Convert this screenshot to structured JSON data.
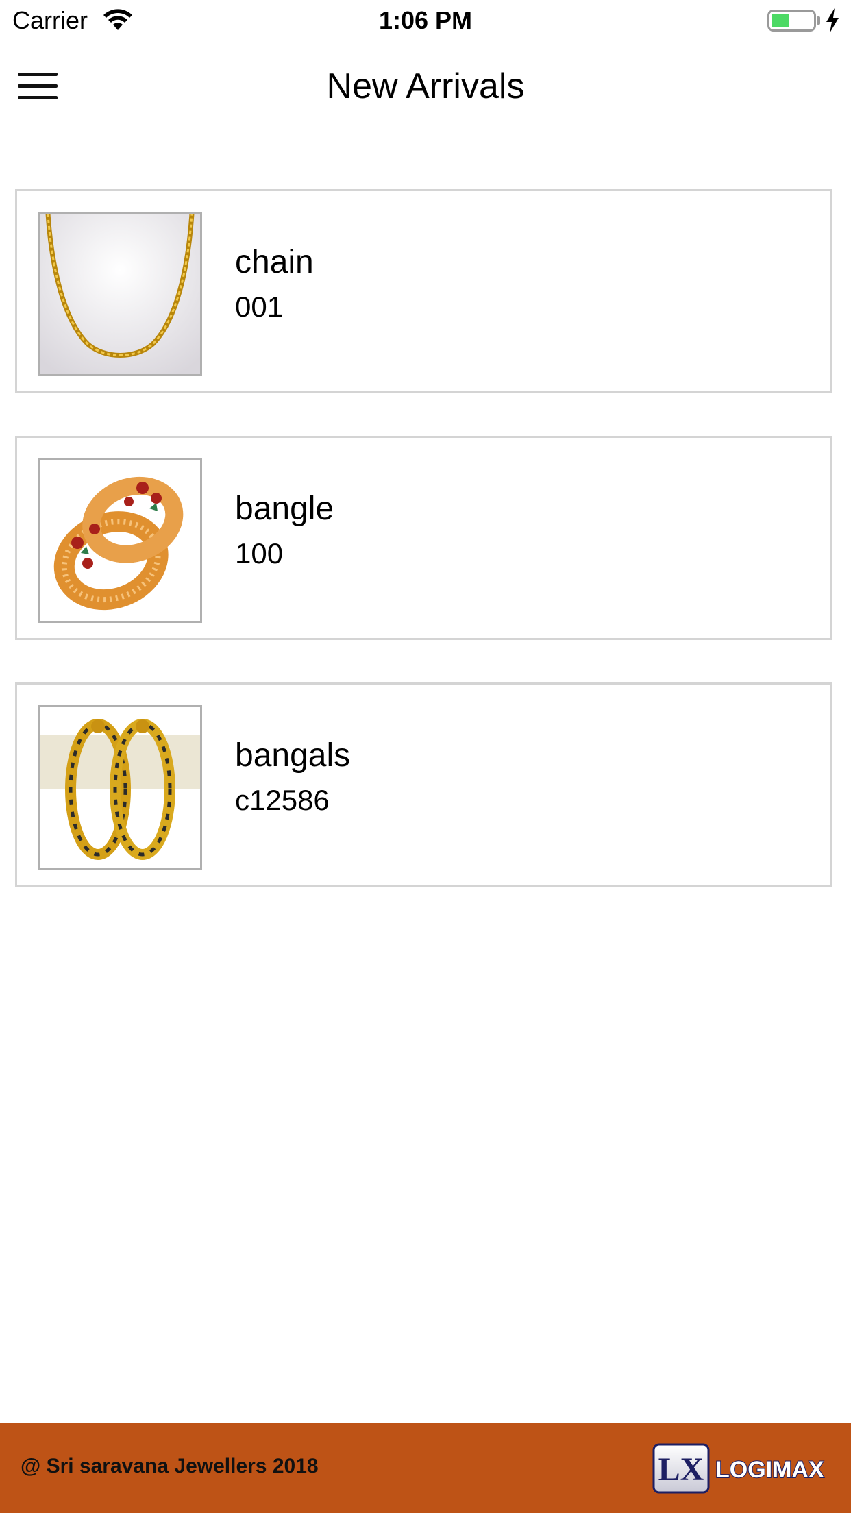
{
  "status_bar": {
    "carrier": "Carrier",
    "time": "1:06 PM",
    "battery_color": "#4cd964",
    "wifi_icon": "wifi-icon",
    "battery_icon": "battery-icon",
    "charging_icon": "bolt-icon"
  },
  "nav": {
    "title": "New Arrivals",
    "menu_icon": "hamburger-icon"
  },
  "products": [
    {
      "name": "chain",
      "code": "001",
      "image": "gold-chain-image"
    },
    {
      "name": "bangle",
      "code": "100",
      "image": "gold-bangle-image"
    },
    {
      "name": "bangals",
      "code": "c12586",
      "image": "gold-bangles-image"
    }
  ],
  "footer": {
    "copyright": "@ Sri saravana Jewellers 2018",
    "logo_mark": "LX",
    "logo_text": "LOGIMAX",
    "background_color": "#be5316"
  }
}
